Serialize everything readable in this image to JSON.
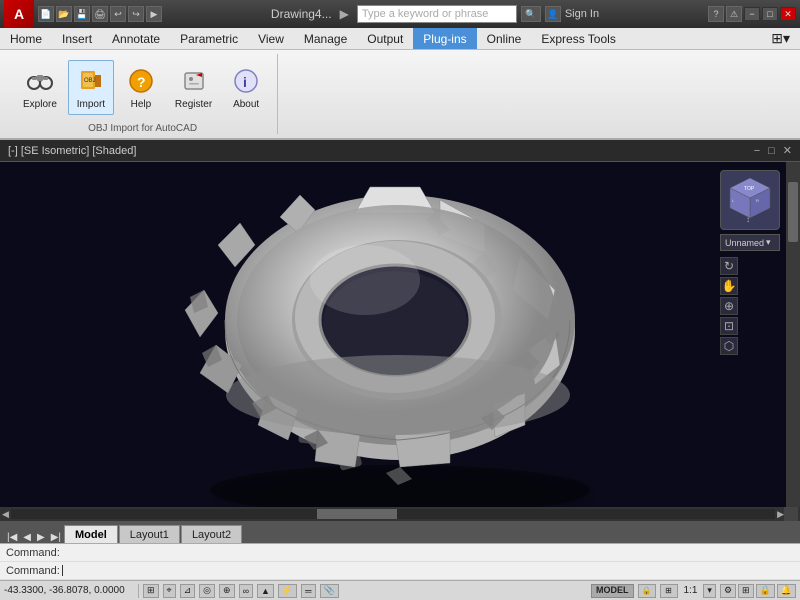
{
  "titlebar": {
    "logo": "A",
    "filename": "Drawing4...",
    "search_placeholder": "Type a keyword or phrase",
    "sign_in": "Sign In",
    "min_label": "−",
    "max_label": "□",
    "close_label": "✕"
  },
  "menubar": {
    "items": [
      "Home",
      "Insert",
      "Annotate",
      "Parametric",
      "View",
      "Manage",
      "Output",
      "Plug-ins",
      "Online",
      "Express Tools"
    ],
    "active_index": 7
  },
  "ribbon": {
    "section_label": "OBJ Import for AutoCAD",
    "buttons": [
      {
        "label": "Explore",
        "icon": "binoculars"
      },
      {
        "label": "Import",
        "icon": "import"
      },
      {
        "label": "Help",
        "icon": "help"
      },
      {
        "label": "Register",
        "icon": "register"
      },
      {
        "label": "About",
        "icon": "info"
      }
    ]
  },
  "viewport": {
    "header_left": "[-] [SE Isometric] [Shaded]",
    "min": "−",
    "max": "□",
    "close": "✕",
    "nav_label": "Unnamed",
    "nav_arrow": "▾"
  },
  "tabs": {
    "items": [
      "Model",
      "Layout1",
      "Layout2"
    ],
    "active_index": 0
  },
  "commands": [
    {
      "label": "Command:",
      "value": ""
    },
    {
      "label": "Command:",
      "value": ""
    }
  ],
  "statusbar": {
    "coords": "-43.3300, -36.8078, 0.0000",
    "model_btn": "MODEL",
    "scale": "1:1",
    "tool_icons": [
      "grid",
      "snap",
      "ortho",
      "polar",
      "osnap",
      "otrack",
      "ducs",
      "dyn",
      "lw",
      "tp"
    ]
  }
}
